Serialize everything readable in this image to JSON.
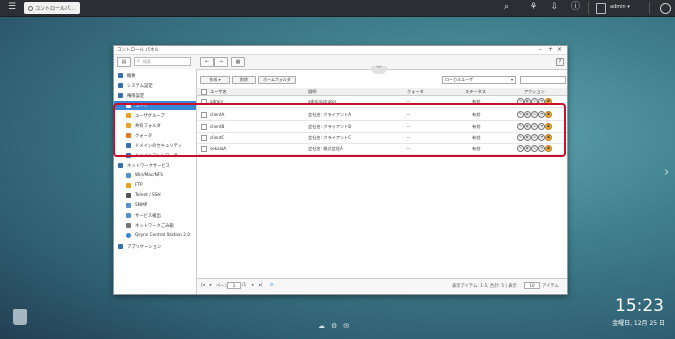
{
  "topbar": {
    "tab_label": "コントロールパ…",
    "username": "admin ▾"
  },
  "desktop": {
    "clock": "15:23",
    "date": "金曜日, 12月 25 日"
  },
  "window": {
    "title": "コントロール パネル",
    "search_placeholder": "検索",
    "help": "?"
  },
  "sidebar": {
    "items": [
      {
        "label": "概要"
      },
      {
        "label": "システム設定"
      },
      {
        "label": "権限設定"
      },
      {
        "label": "ユーザ"
      },
      {
        "label": "ユーザグループ"
      },
      {
        "label": "共有フォルダ"
      },
      {
        "label": "クォータ"
      },
      {
        "label": "ドメインのセキュリティ"
      },
      {
        "label": "ドメインコントローラ"
      },
      {
        "label": "ネットワークサービス"
      },
      {
        "label": "Win/Mac/NFS"
      },
      {
        "label": "FTP"
      },
      {
        "label": "Telnet / SSH"
      },
      {
        "label": "SNMP"
      },
      {
        "label": "サービス検出"
      },
      {
        "label": "ネットワークごみ箱"
      },
      {
        "label": "Qsync Central Station 2.0"
      },
      {
        "label": "アプリケーション"
      }
    ]
  },
  "content": {
    "btn_create": "作成 ▾",
    "btn_delete": "削除",
    "btn_home": "ホームフォルダ",
    "select_value": "ローカルユーザ",
    "columns": [
      "ユーザ名",
      "説明",
      "クォータ",
      "ステータス",
      "アクション"
    ],
    "rows": [
      {
        "name": "admin",
        "desc": "administrator",
        "quota": "--",
        "status": "有効"
      },
      {
        "name": "clientA",
        "desc": "会社名: クライアントA",
        "quota": "--",
        "status": "有効"
      },
      {
        "name": "clientB",
        "desc": "会社名: クライアントB",
        "quota": "--",
        "status": "有効"
      },
      {
        "name": "clientC",
        "desc": "会社名: クライアントC",
        "quota": "--",
        "status": "有効"
      },
      {
        "name": "sekaiaA",
        "desc": "会社名: 株式会社A",
        "quota": "--",
        "status": "有効"
      }
    ],
    "pager": {
      "page_label": "ページ",
      "page_value": "1",
      "of_label": "/1",
      "summary": "表示アイテム: 1-5, 合計: 5 | 表示",
      "per_page": "10",
      "items_label": "アイテム"
    }
  },
  "colors": {
    "accent": "#3a86d6",
    "highlight": "#c8102e",
    "action_orange": "#f4b13a"
  }
}
